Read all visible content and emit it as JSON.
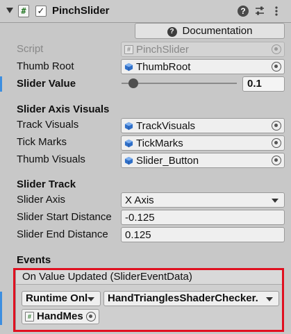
{
  "header": {
    "title": "PinchSlider",
    "enabled": true,
    "script_glyph": "#"
  },
  "documentation_label": "Documentation",
  "fields": {
    "script": {
      "label": "Script",
      "value": "PinchSlider"
    },
    "thumb_root": {
      "label": "Thumb Root",
      "value": "ThumbRoot"
    },
    "slider_value": {
      "label": "Slider Value",
      "value": "0.1",
      "fraction": 0.1
    }
  },
  "axis_visuals": {
    "heading": "Slider Axis Visuals",
    "track_visuals": {
      "label": "Track Visuals",
      "value": "TrackVisuals"
    },
    "tick_marks": {
      "label": "Tick Marks",
      "value": "TickMarks"
    },
    "thumb_visuals": {
      "label": "Thumb Visuals",
      "value": "Slider_Button"
    }
  },
  "track": {
    "heading": "Slider Track",
    "axis": {
      "label": "Slider Axis",
      "value": "X Axis"
    },
    "start": {
      "label": "Slider Start Distance",
      "value": "-0.125"
    },
    "end": {
      "label": "Slider End Distance",
      "value": "0.125"
    }
  },
  "events": {
    "heading": "Events",
    "on_value_updated": "On Value Updated (SliderEventData)",
    "runtime_mode": "Runtime Onl",
    "function": "HandTrianglesShaderChecker.",
    "target_object": "HandMes"
  },
  "colors": {
    "highlight_outline": "#e01020",
    "field_marker": "#3c8ee0"
  }
}
